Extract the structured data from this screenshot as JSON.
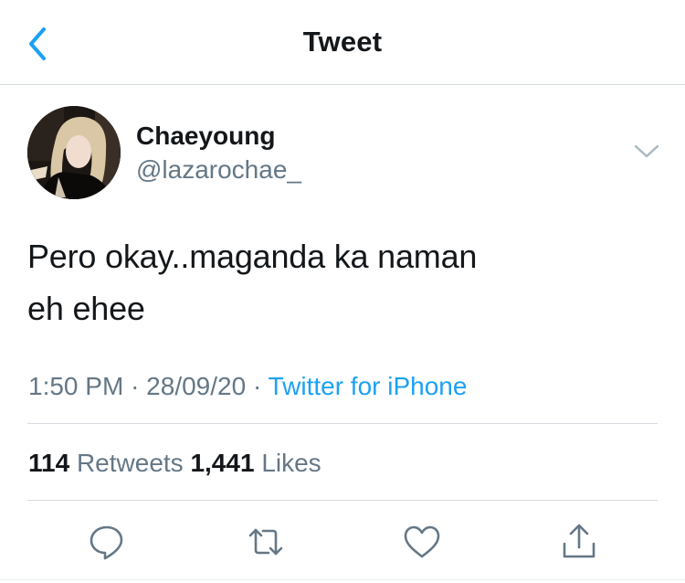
{
  "header": {
    "title": "Tweet",
    "back_icon": "chevron-left-icon",
    "accent": "#1da1f2"
  },
  "tweet": {
    "author": {
      "display_name": "Chaeyoung",
      "handle": "@lazarochae_"
    },
    "text_lines": [
      "Pero okay..maganda ka naman",
      "eh ehee"
    ],
    "time": "1:50 PM",
    "date": "28/09/20",
    "separator": "·",
    "source": "Twitter for iPhone"
  },
  "stats": {
    "retweets_count": "114",
    "retweets_label": "Retweets",
    "likes_count": "1,441",
    "likes_label": "Likes"
  },
  "actions": [
    {
      "icon": "reply-icon"
    },
    {
      "icon": "retweet-icon"
    },
    {
      "icon": "like-icon"
    },
    {
      "icon": "share-icon"
    }
  ],
  "colors": {
    "text_primary": "#14171a",
    "text_secondary": "#657786",
    "link": "#1da1f2",
    "divider": "#d6dbdf"
  }
}
